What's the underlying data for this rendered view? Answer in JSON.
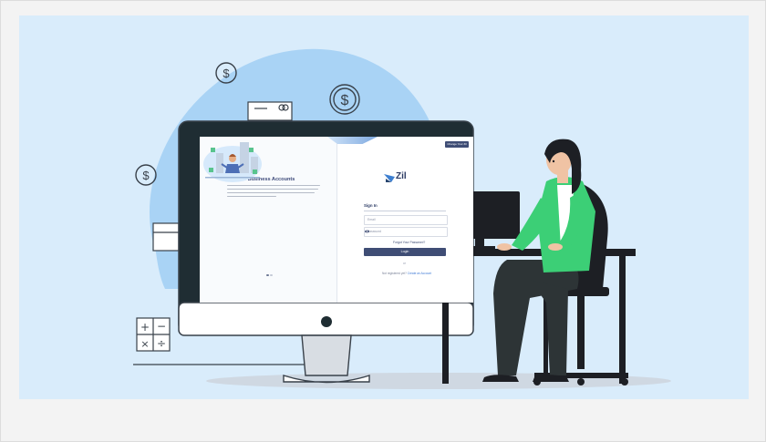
{
  "screen": {
    "left_panel": {
      "title": "Multiple Business Accounts"
    },
    "top_right_button": "Change Your Zil",
    "brand": "Zil",
    "signin_title": "Sign In",
    "email_placeholder": "Email",
    "password_placeholder": "Password",
    "forgot_password": "Forgot Your Password?",
    "login_button": "Login",
    "or_text": "or",
    "register_prompt": "Not registered yet?",
    "register_link": "Create an Account"
  },
  "colors": {
    "background_blue": "#d9ecfb",
    "blob_blue": "#a9d3f5",
    "monitor_dark": "#1f2d33",
    "jacket_green": "#3ccf76",
    "brand_navy": "#3f4d75"
  },
  "icons": [
    "dollar-coin-icon",
    "credit-card-icon",
    "calculator-icon",
    "visibility-eye-icon"
  ]
}
